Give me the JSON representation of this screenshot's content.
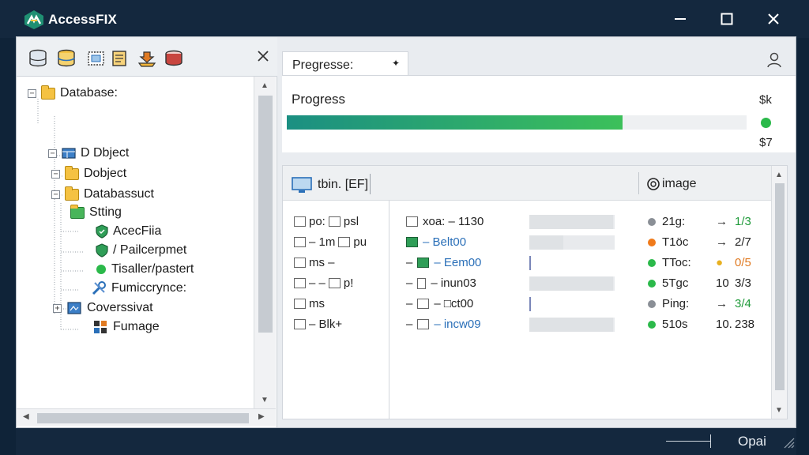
{
  "app": {
    "title": "AccessFIX"
  },
  "colors": {
    "titlebar": "#14283e",
    "progress_start": "#1b8f82",
    "progress_end": "#3cc05a",
    "link": "#2a6fb8",
    "green": "#2bb94a",
    "orange": "#f07a1a",
    "gray": "#8a8f96",
    "yellow": "#e8b020"
  },
  "toolbar": {
    "icons": [
      "database-icon",
      "database-yellow-icon",
      "query-icon",
      "form-icon",
      "import-icon",
      "table-red-icon"
    ],
    "close_label": "×"
  },
  "tree": {
    "items": [
      {
        "label": "Database:",
        "icon": "folder-icon",
        "expander": "+"
      },
      {
        "label": "D Dbject",
        "icon": "table-blue-icon",
        "expander": "+"
      },
      {
        "label": "Dobject",
        "icon": "folder-icon",
        "expander": "+"
      },
      {
        "label": "Databassuct",
        "icon": "folder-icon",
        "expander": "+"
      },
      {
        "label": "Stting",
        "icon": "green-folder-icon",
        "expander": ""
      },
      {
        "label": "AcecFiia",
        "icon": "shield-icon",
        "expander": ""
      },
      {
        "label": "/ Pailcerpmet",
        "icon": "shield-icon",
        "expander": ""
      },
      {
        "label": "Tisaller/pastert",
        "icon": "green-dot-icon",
        "expander": ""
      },
      {
        "label": "Fumiccrynce:",
        "icon": "wrench-icon",
        "expander": ""
      },
      {
        "label": "Coverssivat",
        "icon": "form-icon",
        "expander": "+"
      },
      {
        "label": "Fumage",
        "icon": "puzzle-icon",
        "expander": ""
      }
    ]
  },
  "progress_tab": {
    "label": "Pregresse:",
    "pin": "✦"
  },
  "progress": {
    "label": "Progress",
    "fraction": 0.73,
    "value_top": "$k",
    "value_bottom": "$7"
  },
  "list": {
    "header_left": "tbin. [EF]",
    "header_right": "image",
    "rows": [
      {
        "a1": "po:",
        "a2": "psl",
        "b_prefix": "",
        "b_icon": "folder-icon",
        "b_code": "xoa: – 1130",
        "b_code_style": "plain",
        "bar": 0.98,
        "dot": "gray",
        "status": "21g:",
        "arrow": "→",
        "val": "1/3",
        "val_color": "green"
      },
      {
        "a1": "– 1m",
        "a2": "pu",
        "b_prefix": "",
        "b_icon": "folder-shield-icon",
        "b_code": "– Belt00",
        "b_code_style": "link",
        "bar": 0.4,
        "dot": "orange",
        "status": "T1öc",
        "arrow": "→",
        "val": "2/7",
        "val_color": "dark"
      },
      {
        "a1": "ms –",
        "a2": "",
        "b_prefix": "–",
        "b_icon": "shield-icon",
        "b_code": "– Eem00",
        "b_code_style": "link",
        "bar": 0.0,
        "dot": "green",
        "status": "TToc:",
        "arrow": "●",
        "val": "0/5",
        "val_color": "orange"
      },
      {
        "a1": "– –",
        "a2": "p!",
        "b_prefix": "–",
        "b_icon": "doc-icon",
        "b_code": "– inun03",
        "b_code_style": "plain",
        "bar": 0.98,
        "dot": "green",
        "status": "5Tgc",
        "arrow": "10",
        "val": "3/3",
        "val_color": "dark"
      },
      {
        "a1": "ms",
        "a2": "",
        "b_prefix": "–",
        "b_icon": "folder-arrow-icon",
        "b_code": "– □ct00",
        "b_code_style": "plain",
        "bar": 0.0,
        "dot": "gray",
        "status": "Ping:",
        "arrow": "→",
        "val": "3/4",
        "val_color": "green"
      },
      {
        "a1": "– Blk+",
        "a2": "",
        "b_prefix": "–",
        "b_icon": "check-icon",
        "b_code": "– incw09",
        "b_code_style": "link",
        "bar": 0.98,
        "dot": "green",
        "status": "510s",
        "arrow": "10.",
        "val": "238",
        "val_color": "dark"
      }
    ]
  },
  "statusbar": {
    "text": "Opai"
  }
}
